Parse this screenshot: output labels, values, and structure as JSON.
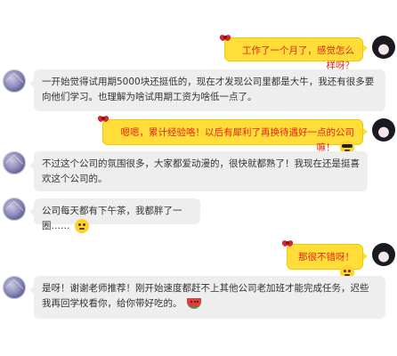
{
  "messages": [
    {
      "side": "self",
      "text": "工作了一个月了，感觉怎么样呀？",
      "emoji": ""
    },
    {
      "side": "other",
      "text": "一开始觉得试用期5000块还挺低的，现在才发现公司里都是大牛，我还有很多要向他们学习。也理解为啥试用期工资为啥低一点了。",
      "emoji": ""
    },
    {
      "side": "self",
      "text": "嗯嗯，累计经验咯！以后有犀利了再换待遇好一点的公司嘛！",
      "emoji": "cool-emoji"
    },
    {
      "side": "other",
      "text": "不过这个公司的氛围很多，大家都爱动漫的，很快就都熟了！我现在还是挺喜欢这个公司的。",
      "emoji": ""
    },
    {
      "side": "other",
      "text": "公司每天都有下午茶，我都胖了一圈……",
      "emoji": "shy-emoji"
    },
    {
      "side": "self",
      "text": "那很不错呀！",
      "emoji": "smile-emoji"
    },
    {
      "side": "other",
      "text": "是呀！谢谢老师推荐！刚开始速度都赶不上其他公司老加班才能完成任务，迟些我再回学校看你，给你带好吃的。",
      "emoji": "watermelon-emoji"
    }
  ],
  "colors": {
    "self_bubble": "#ffde39",
    "self_text": "#e0241b",
    "other_bubble": "#eeeeee",
    "other_text": "#333333"
  }
}
